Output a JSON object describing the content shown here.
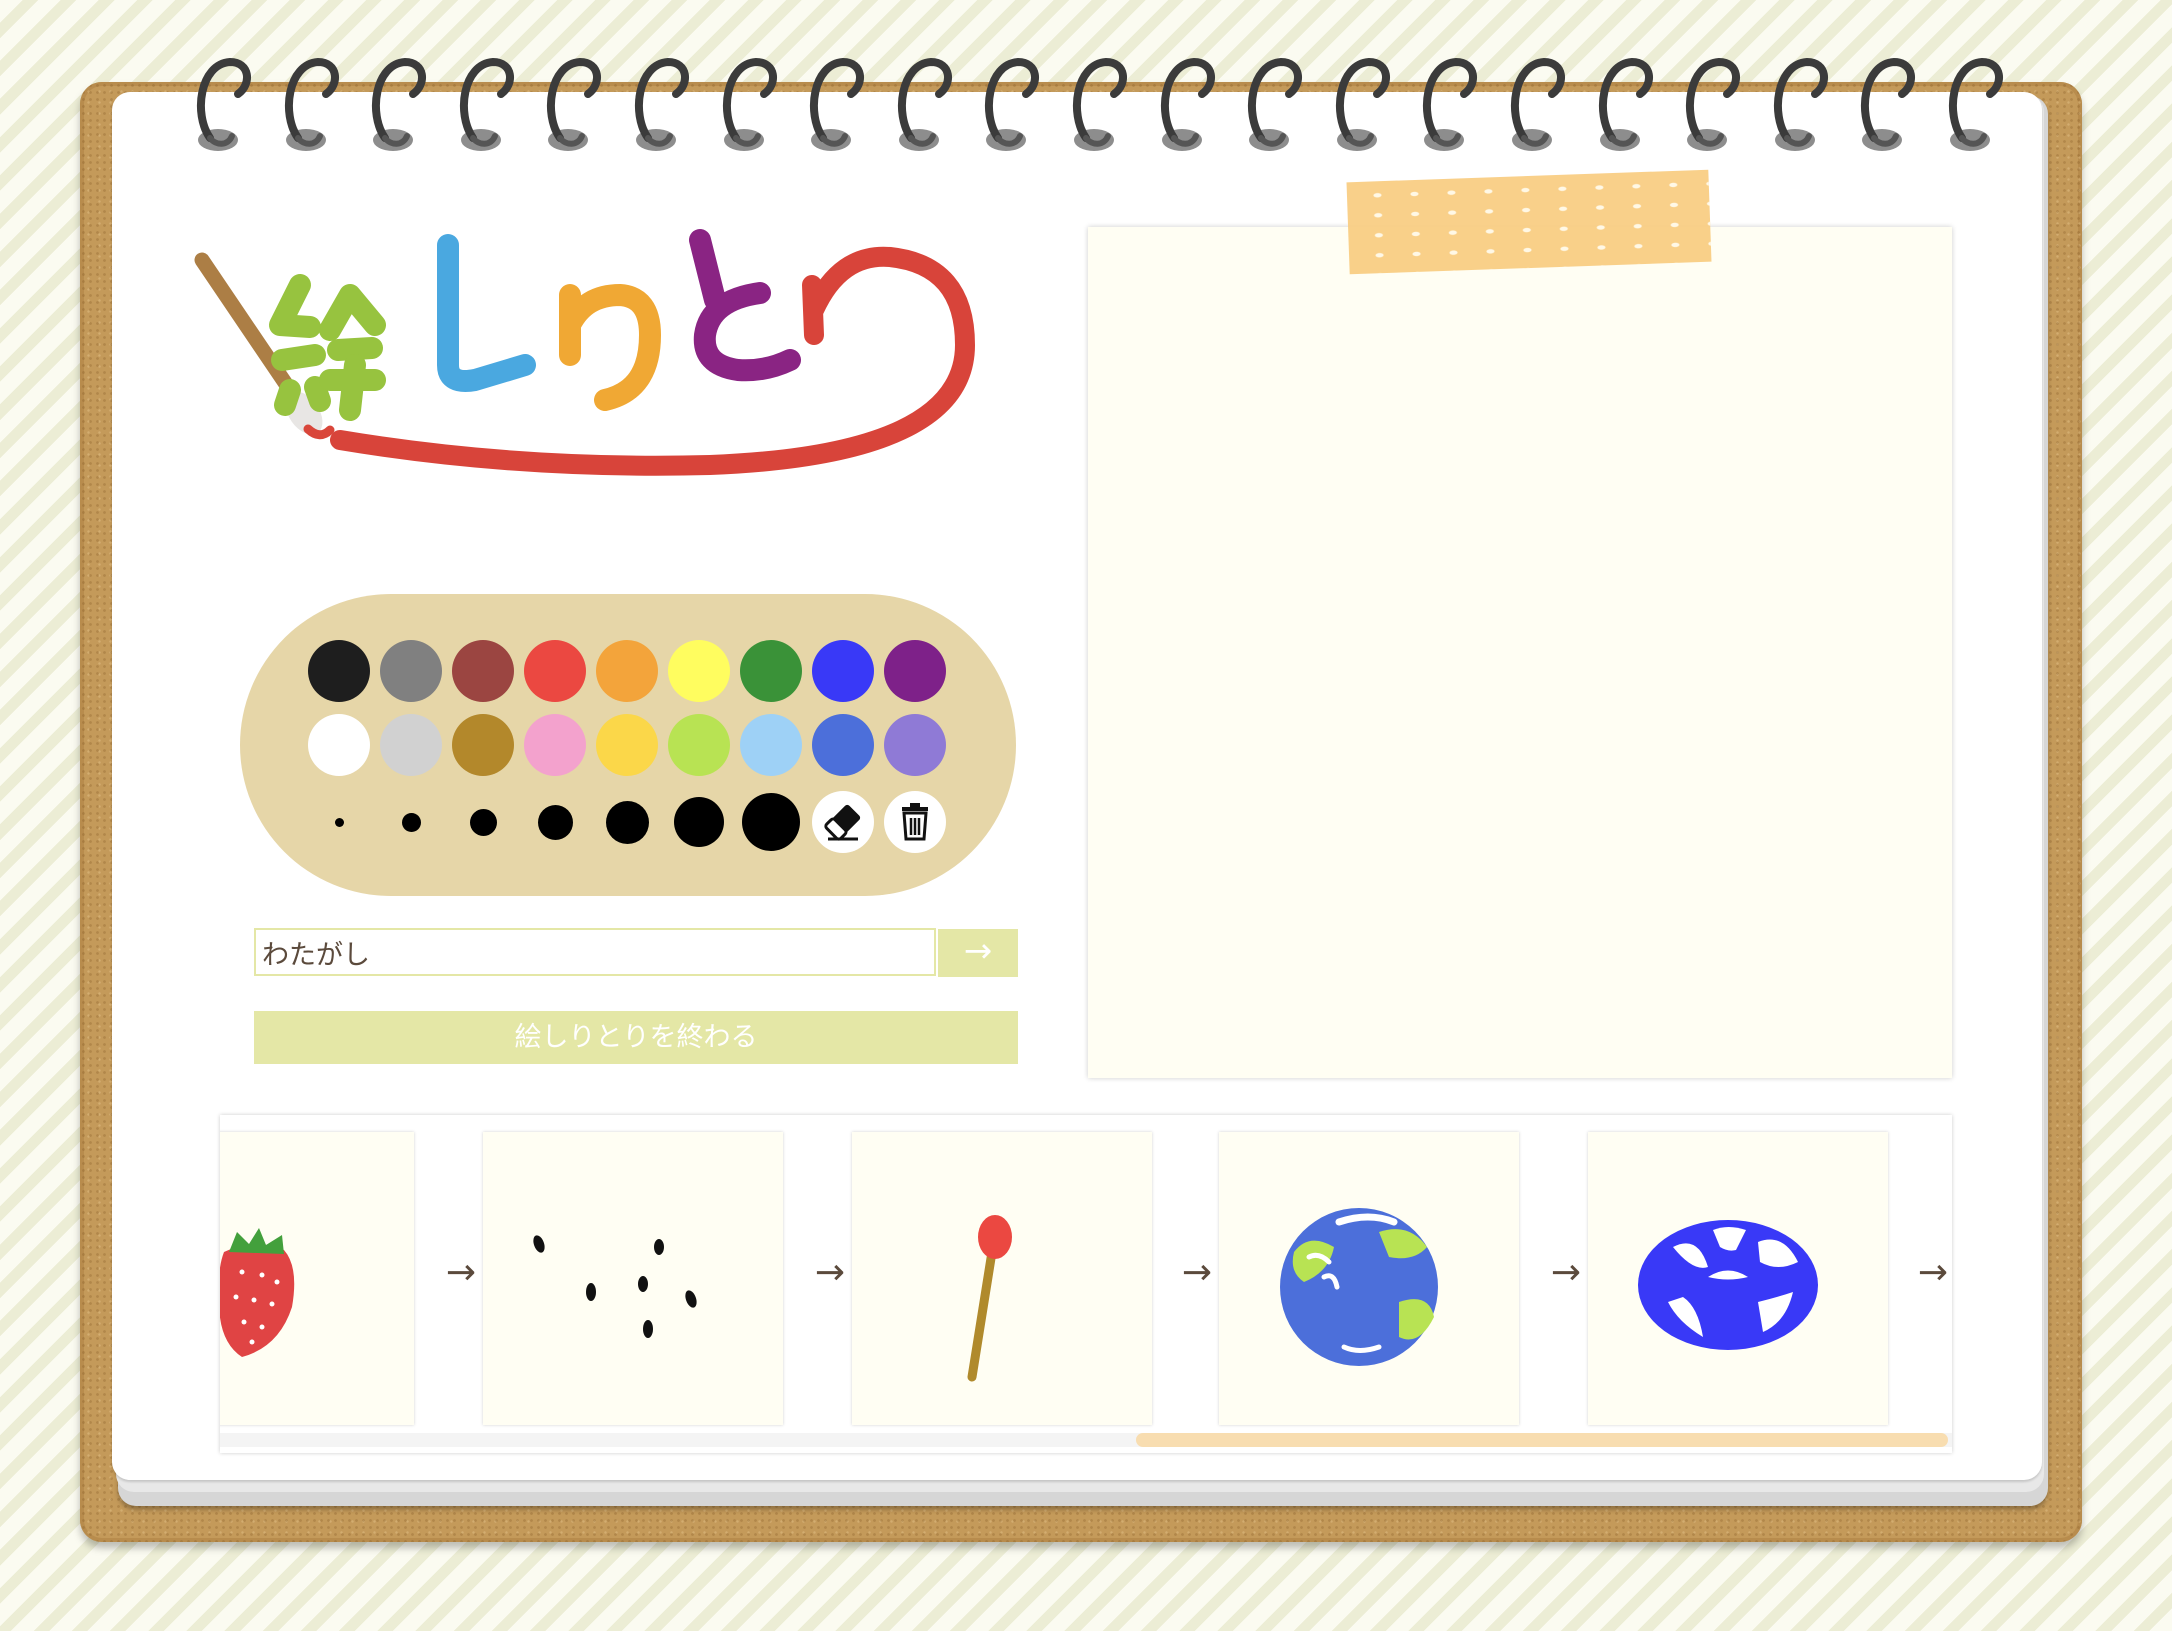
{
  "app": {
    "title": "絵しりとり"
  },
  "palette": {
    "colors_row1": [
      "#1e1e1e",
      "#808080",
      "#9b4541",
      "#eb4841",
      "#f3a43b",
      "#fffd5f",
      "#3a9238",
      "#3939f7",
      "#7e2189"
    ],
    "colors_row2": [
      "#ffffff",
      "#d1d1d1",
      "#b3882b",
      "#f3a2cd",
      "#fbd749",
      "#b8e353",
      "#9ed1f6",
      "#4c6fda",
      "#8f7ad6"
    ],
    "brush_sizes": [
      "size-1",
      "size-2",
      "size-3",
      "size-4",
      "size-5",
      "size-6",
      "size-7"
    ],
    "tools": [
      "eraser-icon",
      "trash-icon"
    ]
  },
  "answer": {
    "value": "わたがし",
    "submit_label": "→"
  },
  "end_button": {
    "label": "絵しりとりを終わる"
  },
  "history": {
    "items": [
      "strawberry-drawing",
      "seeds-drawing",
      "match-drawing",
      "earth-drawing",
      "blue-ball-drawing"
    ],
    "arrow": "→"
  },
  "colors": {
    "accent": "#e4e7a6",
    "board": "#c49a5a",
    "canvas": "#fffef3",
    "tape": "#f8cc80"
  }
}
